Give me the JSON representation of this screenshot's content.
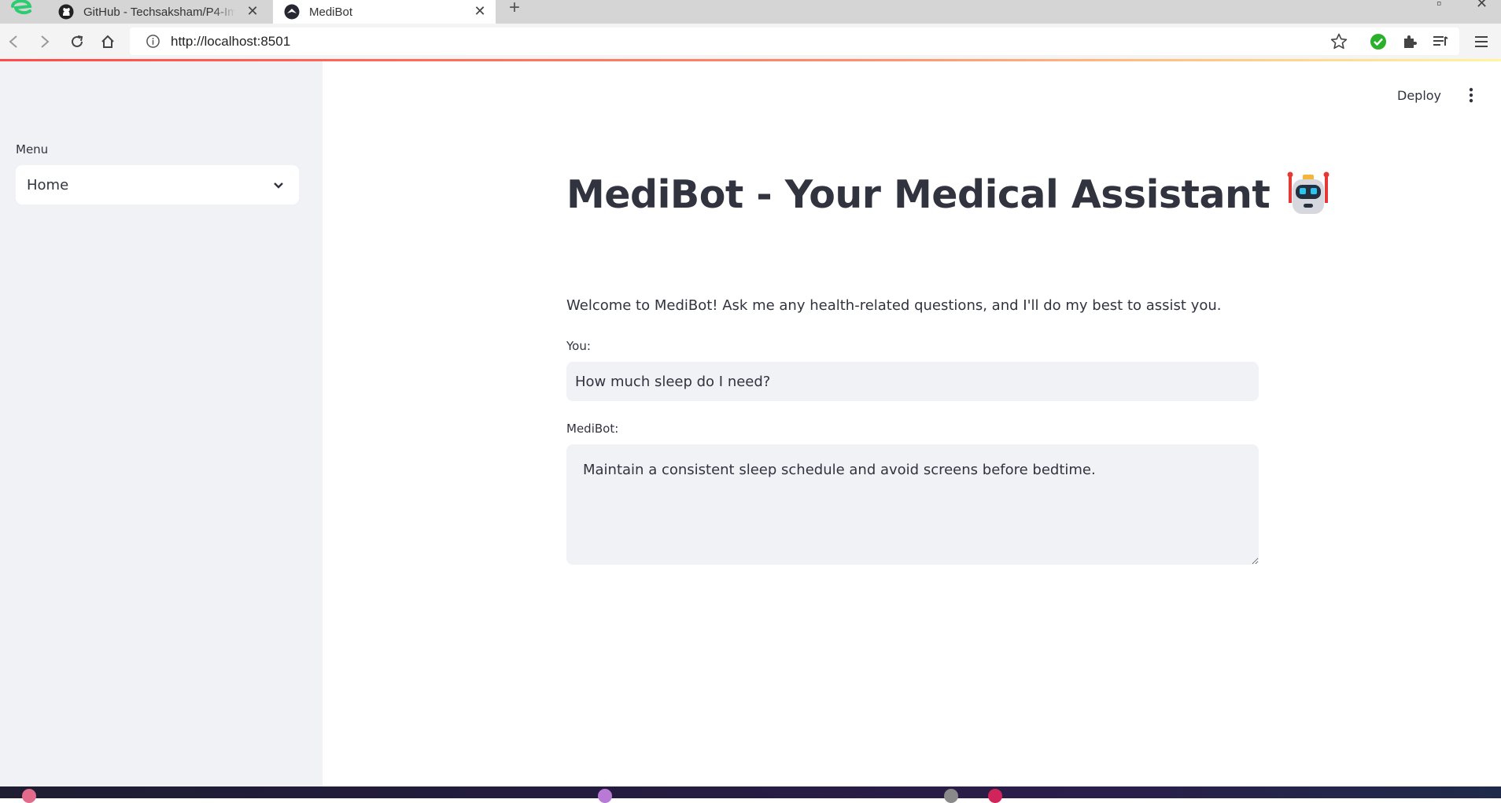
{
  "browser": {
    "tabs": [
      {
        "title": "GitHub - Techsaksham/P4-Im",
        "active": false
      },
      {
        "title": "MediBot",
        "active": true
      }
    ],
    "url": "http://localhost:8501"
  },
  "sidebar": {
    "menu_label": "Menu",
    "menu_selected": "Home"
  },
  "header": {
    "deploy_label": "Deploy"
  },
  "main": {
    "title": "MediBot - Your Medical Assistant",
    "title_icon": "robot-icon",
    "welcome": "Welcome to MediBot! Ask me any health-related questions, and I'll do my best to assist you.",
    "you_label": "You:",
    "you_value": "How much sleep do I need?",
    "bot_label": "MediBot:",
    "bot_value": "Maintain a consistent sleep schedule and avoid screens before bedtime."
  },
  "colors": {
    "accent": "#ff4b4b",
    "text": "#31333f",
    "sidebar_bg": "#f0f2f6",
    "input_bg": "#f0f2f6"
  }
}
